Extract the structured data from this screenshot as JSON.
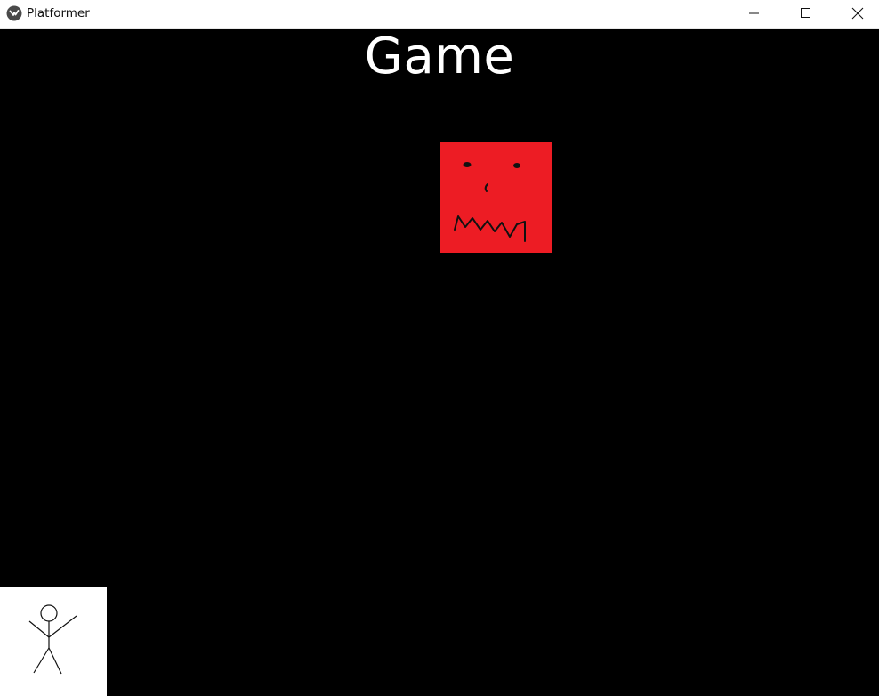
{
  "window": {
    "title": "Platformer",
    "app_icon": "kivy-logo-icon",
    "controls": [
      "minimize-icon",
      "maximize-icon",
      "close-icon"
    ]
  },
  "game": {
    "title": "Game",
    "background_color": "#000000",
    "enemy": {
      "sprite": "angry-red-square-face",
      "color": "#ed1c24"
    },
    "player": {
      "sprite": "stick-figure",
      "background_color": "#ffffff"
    }
  }
}
